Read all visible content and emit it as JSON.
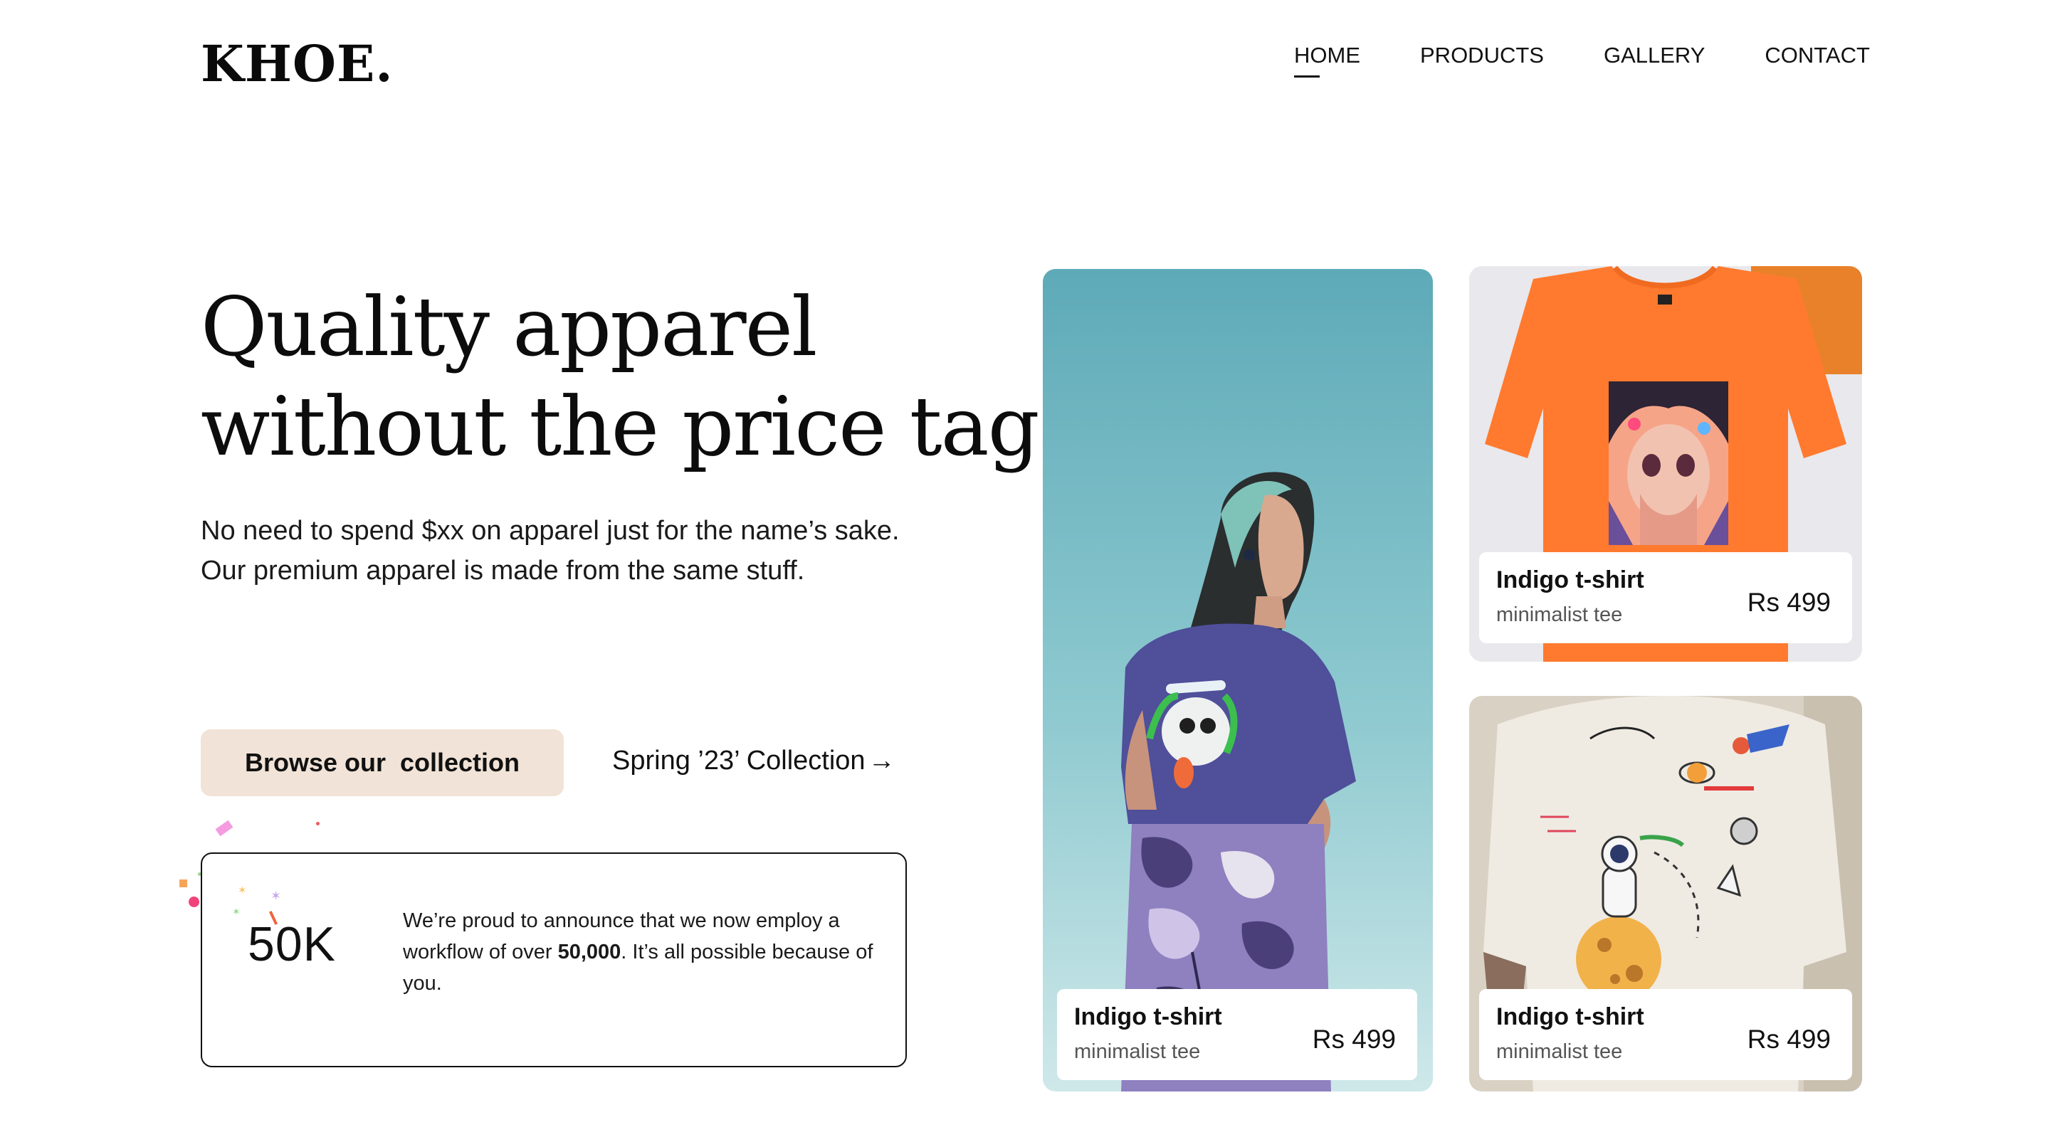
{
  "brand": {
    "logo": "KHOE."
  },
  "nav": {
    "items": [
      {
        "label": "HOME",
        "active": true
      },
      {
        "label": "PRODUCTS",
        "active": false
      },
      {
        "label": "GALLERY",
        "active": false
      },
      {
        "label": "CONTACT",
        "active": false
      }
    ]
  },
  "hero": {
    "headline_line1": "Quality apparel",
    "headline_line2": "without the price tag",
    "subtext": "No need to spend $xx on apparel just for the name’s sake. Our premium apparel is made from the same stuff.",
    "primary_button": "Browse our  collection",
    "secondary_link": "Spring ’23’ Collection",
    "secondary_link_icon": "arrow-right-icon"
  },
  "stat": {
    "value": "50K",
    "text_before": "We’re proud to announce that we now employ a workflow of over ",
    "text_bold": "50,000",
    "text_after": ". It’s all possible because of you."
  },
  "products": [
    {
      "name": "Indigo t-shirt",
      "subtitle": "minimalist tee",
      "price": "Rs 499"
    },
    {
      "name": "Indigo t-shirt",
      "subtitle": "minimalist tee",
      "price": "Rs 499"
    },
    {
      "name": "Indigo t-shirt",
      "subtitle": "minimalist tee",
      "price": "Rs 499"
    }
  ],
  "colors": {
    "button_bg": "#f1e3d7",
    "sky_blue": "#6fb9c4",
    "shirt_indigo": "#4f4f9a",
    "shirt_orange": "#ff7a2e",
    "shirt_white": "#efebe3"
  }
}
